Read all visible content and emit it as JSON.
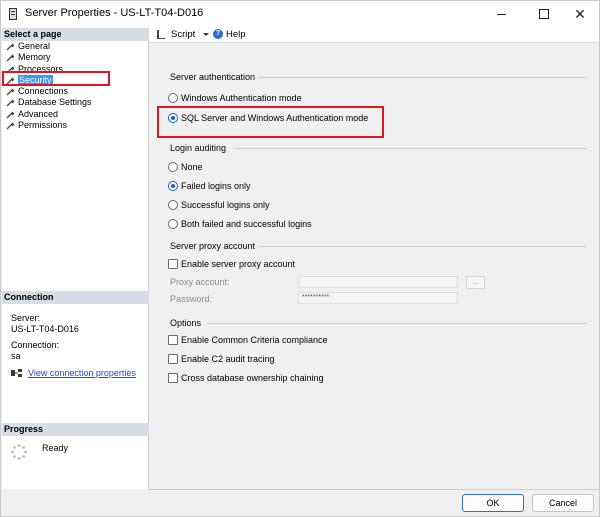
{
  "window": {
    "title": "Server Properties - US-LT-T04-D016",
    "close_glyph": "✕"
  },
  "left": {
    "select_page_heading": "Select a page",
    "pages": [
      {
        "label": "General",
        "selected": false
      },
      {
        "label": "Memory",
        "selected": false
      },
      {
        "label": "Processors",
        "selected": false
      },
      {
        "label": "Security",
        "selected": true
      },
      {
        "label": "Connections",
        "selected": false
      },
      {
        "label": "Database Settings",
        "selected": false
      },
      {
        "label": "Advanced",
        "selected": false
      },
      {
        "label": "Permissions",
        "selected": false
      }
    ],
    "connection_heading": "Connection",
    "server_label": "Server:",
    "server_value": "US-LT-T04-D016",
    "connection_label": "Connection:",
    "connection_value": "sa",
    "view_connection_link": "View connection properties",
    "progress_heading": "Progress",
    "progress_status": "Ready"
  },
  "toolbar": {
    "script_label": "Script",
    "help_label": "Help",
    "help_glyph": "?"
  },
  "server_auth": {
    "title": "Server authentication",
    "options": [
      {
        "label": "Windows Authentication mode",
        "selected": false
      },
      {
        "label": "SQL Server and Windows Authentication mode",
        "selected": true
      }
    ]
  },
  "login_auditing": {
    "title": "Login auditing",
    "options": [
      {
        "label": "None",
        "selected": false
      },
      {
        "label": "Failed logins only",
        "selected": true
      },
      {
        "label": "Successful logins only",
        "selected": false
      },
      {
        "label": "Both failed and successful logins",
        "selected": false
      }
    ]
  },
  "proxy": {
    "title": "Server proxy account",
    "enable_label": "Enable server proxy account",
    "enable_checked": false,
    "account_label": "Proxy account:",
    "account_value": "",
    "password_label": "Password:",
    "password_value": "**********",
    "browse_label": "..."
  },
  "options": {
    "title": "Options",
    "items": [
      {
        "label": "Enable Common Criteria compliance",
        "checked": false
      },
      {
        "label": "Enable C2 audit tracing",
        "checked": false
      },
      {
        "label": "Cross database ownership chaining",
        "checked": false
      }
    ]
  },
  "footer": {
    "ok_label": "OK",
    "cancel_label": "Cancel"
  },
  "colors": {
    "highlight_border": "#e0161e",
    "selection_bg": "#3399ff",
    "section_header_bg": "#d5dde6",
    "link": "#1a4fc2"
  }
}
